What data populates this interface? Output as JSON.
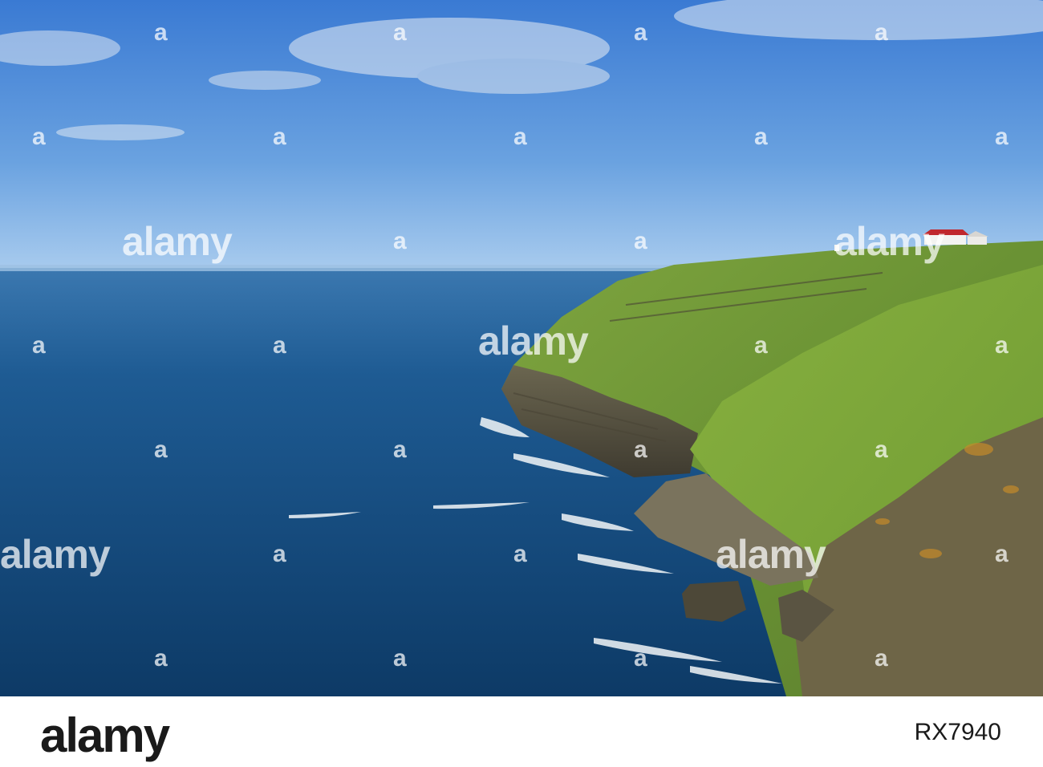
{
  "photo": {
    "subject": "sea-cliff-with-house",
    "colors": {
      "sky_top": "#3b7fd6",
      "sky_bottom": "#9cc3ea",
      "sea_far": "#2f6ea8",
      "sea_near": "#0f3f6e",
      "grass": "#6f9a35",
      "rock": "#5f5a45",
      "roof": "#c0282e",
      "surf": "#f2f6f8"
    }
  },
  "watermark": {
    "logo_text": "alamy",
    "mark_letter": "a"
  },
  "footer": {
    "logo_text": "alamy",
    "image_id": "RX7940"
  }
}
